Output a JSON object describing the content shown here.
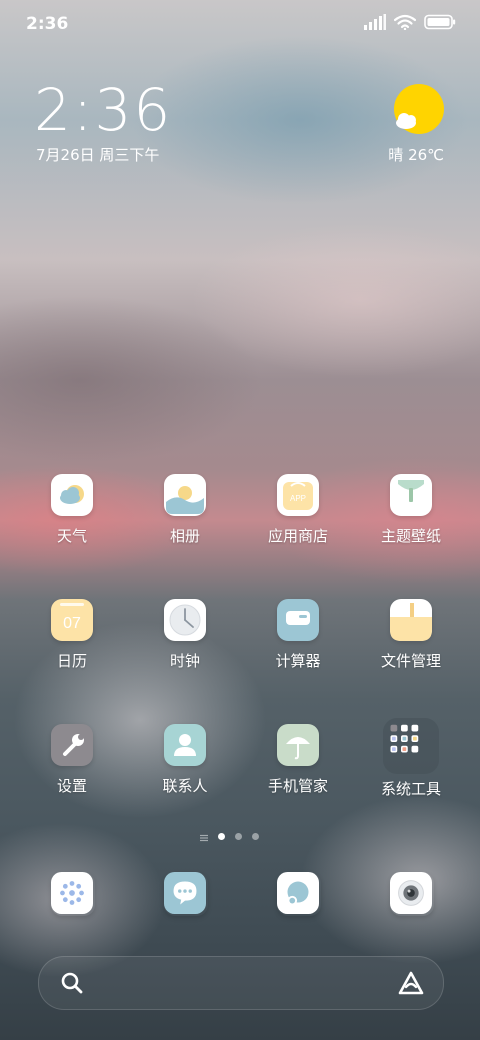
{
  "status_bar": {
    "time": "2:36",
    "icons": [
      "signal-icon",
      "wifi-icon",
      "battery-icon"
    ]
  },
  "clock_widget": {
    "time": "2:36",
    "date": "7月26日 周三下午"
  },
  "weather_widget": {
    "icon": "sunny-cloud-icon",
    "text": "晴 26℃"
  },
  "apps": [
    {
      "label": "天气",
      "icon": "weather-app-icon"
    },
    {
      "label": "相册",
      "icon": "gallery-app-icon"
    },
    {
      "label": "应用商店",
      "icon": "app-store-icon",
      "icon_text": "APP"
    },
    {
      "label": "主题壁纸",
      "icon": "themes-app-icon"
    },
    {
      "label": "日历",
      "icon": "calendar-app-icon",
      "icon_text": "07"
    },
    {
      "label": "时钟",
      "icon": "clock-app-icon"
    },
    {
      "label": "计算器",
      "icon": "calculator-app-icon"
    },
    {
      "label": "文件管理",
      "icon": "file-manager-icon"
    },
    {
      "label": "设置",
      "icon": "settings-app-icon"
    },
    {
      "label": "联系人",
      "icon": "contacts-app-icon"
    },
    {
      "label": "手机管家",
      "icon": "security-app-icon"
    },
    {
      "label": "系统工具",
      "icon": "system-tools-folder-icon"
    }
  ],
  "page_indicator": {
    "pages": 3,
    "active_page": 1
  },
  "dock": [
    {
      "icon": "phone-dialer-icon"
    },
    {
      "icon": "messages-icon"
    },
    {
      "icon": "browser-icon"
    },
    {
      "icon": "camera-icon"
    }
  ],
  "search_bar": {
    "left_icon": "search-icon",
    "right_icon": "assistant-icon"
  },
  "colors": {
    "weather_sun": "#ffd400",
    "icon_background": "#ffffff",
    "accent_teal": "#9cc6d4",
    "accent_yellow": "#fde3a7"
  }
}
